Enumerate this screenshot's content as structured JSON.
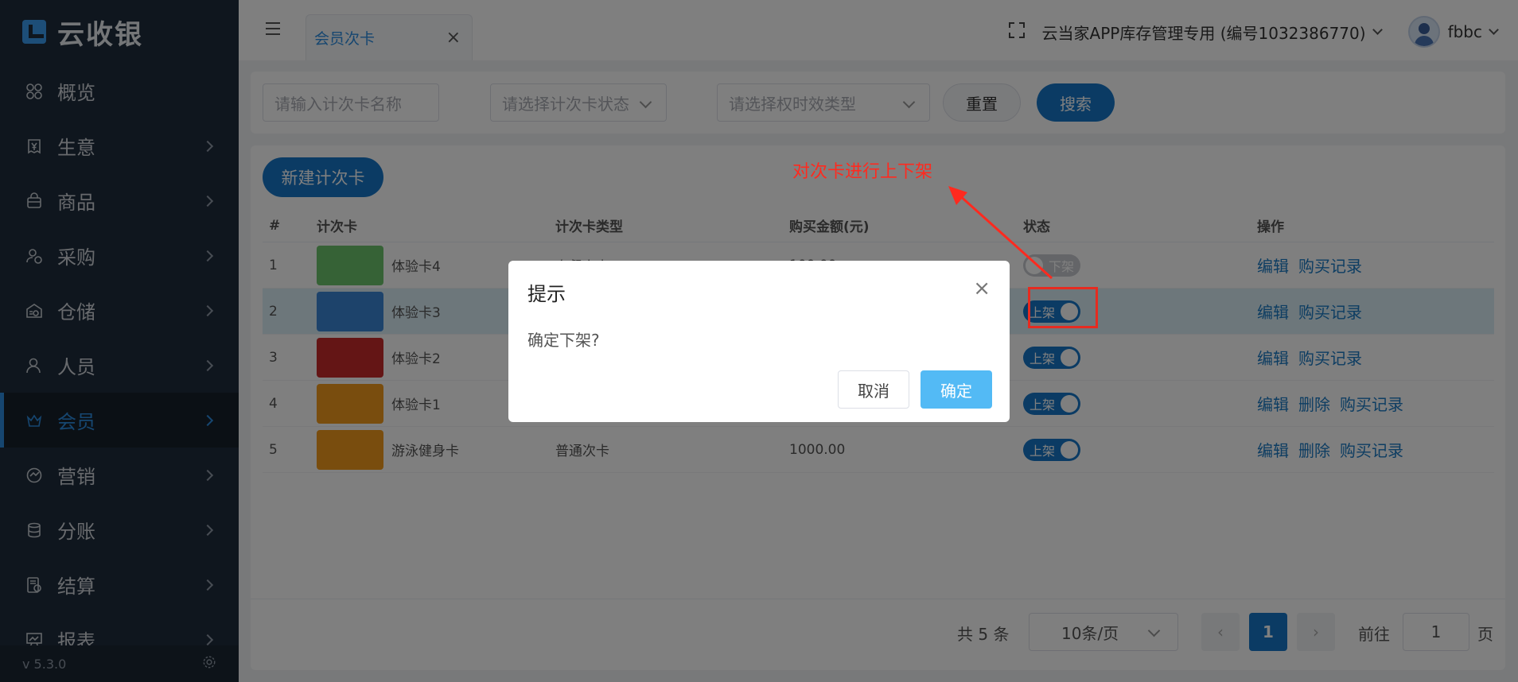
{
  "app": {
    "logo_text": "云收银",
    "version": "v 5.3.0"
  },
  "sidebar": {
    "items": [
      {
        "label": "概览",
        "icon": "grid-icon",
        "has_chevron": false
      },
      {
        "label": "生意",
        "icon": "yen-doc-icon",
        "has_chevron": true
      },
      {
        "label": "商品",
        "icon": "bag-icon",
        "has_chevron": true
      },
      {
        "label": "采购",
        "icon": "purchase-user-icon",
        "has_chevron": true
      },
      {
        "label": "仓储",
        "icon": "warehouse-icon",
        "has_chevron": true
      },
      {
        "label": "人员",
        "icon": "person-icon",
        "has_chevron": true
      },
      {
        "label": "会员",
        "icon": "crown-icon",
        "has_chevron": true,
        "active": true
      },
      {
        "label": "营销",
        "icon": "marketing-icon",
        "has_chevron": true
      },
      {
        "label": "分账",
        "icon": "database-icon",
        "has_chevron": true
      },
      {
        "label": "结算",
        "icon": "settlement-icon",
        "has_chevron": true
      },
      {
        "label": "报表",
        "icon": "chart-board-icon",
        "has_chevron": true
      }
    ]
  },
  "topbar": {
    "tab_label": "会员次卡",
    "store_name": "云当家APP库存管理专用 (编号1032386770)",
    "username": "fbbc"
  },
  "filter": {
    "name_placeholder": "请输入计次卡名称",
    "status_placeholder": "请选择计次卡状态",
    "type_placeholder": "请选择权时效类型",
    "reset_label": "重置",
    "search_label": "搜索"
  },
  "main": {
    "new_button": "新建计次卡",
    "columns": [
      "#",
      "计次卡",
      "计次卡类型",
      "购买金额(元)",
      "状态",
      "操作"
    ],
    "rows": [
      {
        "no": "1",
        "name": "体验卡4",
        "type": "套餐次卡",
        "price": "100.00",
        "status": "下架",
        "on": false,
        "color": "#6cc56c",
        "ops": [
          "编辑",
          "购买记录"
        ]
      },
      {
        "no": "2",
        "name": "体验卡3",
        "type": "",
        "price": "",
        "status": "上架",
        "on": true,
        "color": "#3a86d6",
        "ops": [
          "编辑",
          "购买记录"
        ]
      },
      {
        "no": "3",
        "name": "体验卡2",
        "type": "",
        "price": "",
        "status": "上架",
        "on": true,
        "color": "#c92b2b",
        "ops": [
          "编辑",
          "购买记录"
        ]
      },
      {
        "no": "4",
        "name": "体验卡1",
        "type": "",
        "price": "",
        "status": "上架",
        "on": true,
        "color": "#f39a1c",
        "ops": [
          "编辑",
          "删除",
          "购买记录"
        ]
      },
      {
        "no": "5",
        "name": "游泳健身卡",
        "type": "普通次卡",
        "price": "1000.00",
        "status": "上架",
        "on": true,
        "color": "#f39a1c",
        "ops": [
          "编辑",
          "删除",
          "购买记录"
        ]
      }
    ]
  },
  "pagination": {
    "total_text": "共 5 条",
    "page_size": "10条/页",
    "current_page": "1",
    "goto_label": "前往",
    "goto_value": "1",
    "page_suffix": "页"
  },
  "annotation": {
    "text": "对次卡进行上下架",
    "color": "#ff2a1f"
  },
  "modal": {
    "title": "提示",
    "message": "确定下架?",
    "cancel_label": "取消",
    "confirm_label": "确定"
  },
  "colors": {
    "primary": "#1677c8",
    "sidebar_bg": "#1f2d3d",
    "active": "#2c8de0",
    "confirm": "#53baf5"
  }
}
